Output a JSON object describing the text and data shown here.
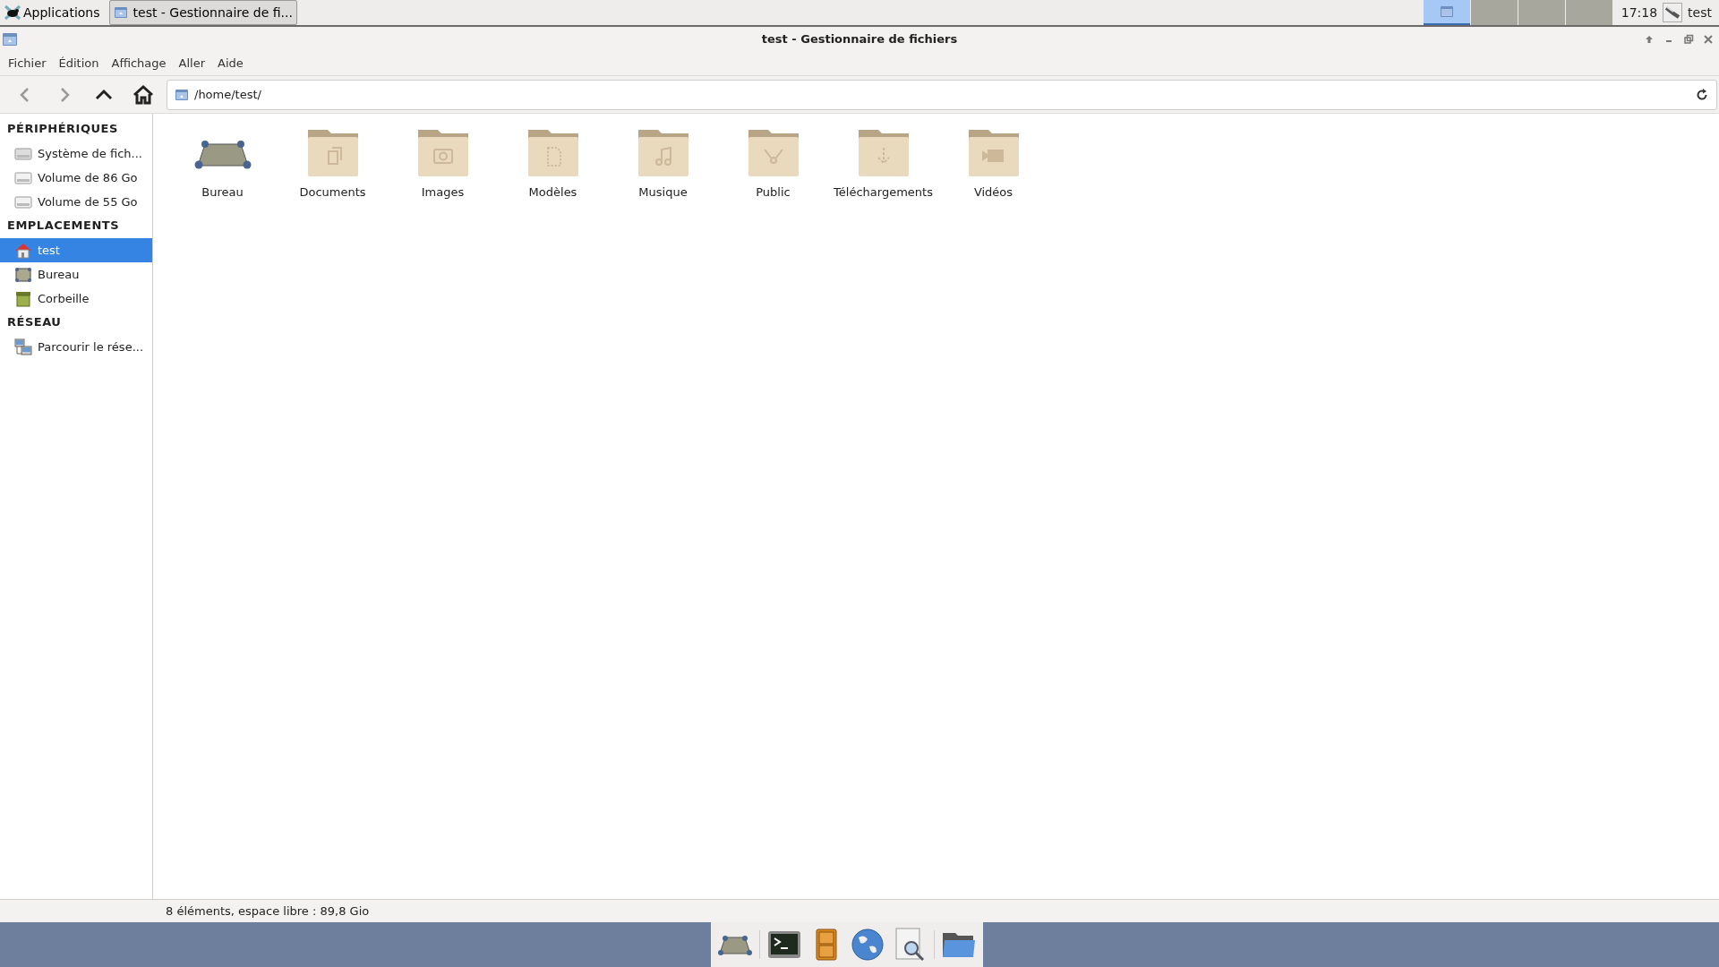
{
  "top_panel": {
    "applications": "Applications",
    "task": {
      "title": "test - Gestionnaire de fi...",
      "selected": true
    },
    "workspaces": [
      {
        "selected": true
      },
      {
        "selected": false
      },
      {
        "selected": false
      },
      {
        "selected": false
      }
    ],
    "clock": "17:18",
    "user": "test"
  },
  "window": {
    "title": "test - Gestionnaire de fichiers"
  },
  "menu": [
    "Fichier",
    "Édition",
    "Affichage",
    "Aller",
    "Aide"
  ],
  "location": "/home/test/",
  "sidebar": {
    "sections": [
      {
        "title": "PÉRIPHÉRIQUES",
        "items": [
          {
            "label": "Système de fich...",
            "kind": "drive",
            "selected": false
          },
          {
            "label": "Volume de 86 Go",
            "kind": "volume",
            "selected": false
          },
          {
            "label": "Volume de 55 Go",
            "kind": "volume",
            "selected": false
          }
        ]
      },
      {
        "title": "EMPLACEMENTS",
        "items": [
          {
            "label": "test",
            "kind": "home",
            "selected": true
          },
          {
            "label": "Bureau",
            "kind": "desktop",
            "selected": false
          },
          {
            "label": "Corbeille",
            "kind": "trash",
            "selected": false
          }
        ]
      },
      {
        "title": "RÉSEAU",
        "items": [
          {
            "label": "Parcourir le rése...",
            "kind": "network",
            "selected": false
          }
        ]
      }
    ]
  },
  "files": [
    {
      "name": "Bureau",
      "kind": "desktop"
    },
    {
      "name": "Documents",
      "kind": "documents"
    },
    {
      "name": "Images",
      "kind": "pictures"
    },
    {
      "name": "Modèles",
      "kind": "templates"
    },
    {
      "name": "Musique",
      "kind": "music"
    },
    {
      "name": "Public",
      "kind": "public"
    },
    {
      "name": "Téléchargements",
      "kind": "downloads"
    },
    {
      "name": "Vidéos",
      "kind": "videos"
    }
  ],
  "status_bar": "8 éléments, espace libre : 89,8 Gio",
  "dock": [
    {
      "kind": "desktop"
    },
    {
      "kind": "terminal"
    },
    {
      "kind": "cabinet"
    },
    {
      "kind": "globe"
    },
    {
      "kind": "search"
    },
    {
      "kind": "folder"
    }
  ]
}
